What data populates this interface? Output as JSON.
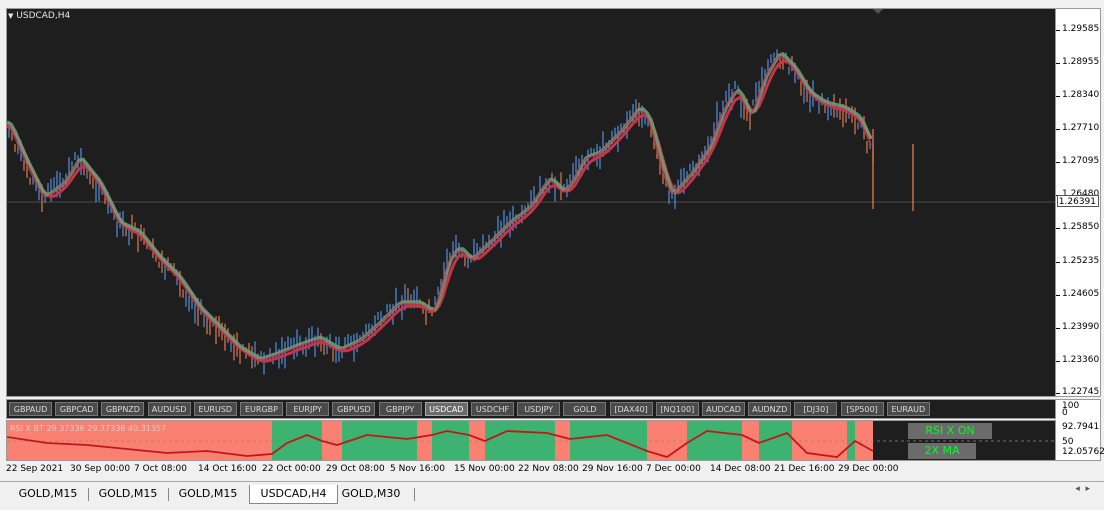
{
  "window": {
    "symbol_title": "USDCAD,H4"
  },
  "price_axis": {
    "labels": [
      "1.29585",
      "1.28955",
      "1.28340",
      "1.27710",
      "1.27095",
      "1.26480",
      "1.25850",
      "1.25235",
      "1.24605",
      "1.23990",
      "1.23360",
      "1.22745"
    ],
    "current_price": "1.26391"
  },
  "symbol_buttons": [
    "GBPAUD",
    "GBPCAD",
    "GBPNZD",
    "AUDUSD",
    "EURUSD",
    "EURGBP",
    "EURJPY",
    "GBPUSD",
    "GBPJPY",
    "USDCAD",
    "USDCHF",
    "USDJPY",
    "GOLD",
    "[DAX40]",
    "[NQ100]",
    "AUDCAD",
    "AUDNZD",
    "[DJ30]",
    "[SP500]",
    "EURAUD"
  ],
  "active_symbol": "USDCAD",
  "indicator": {
    "label": "RSI X BT 29.37336 29.37336 40.31357",
    "btn_rsi": "RSI X ON",
    "btn_ma": "2X MA",
    "axis_labels": [
      "100",
      "92.7941",
      "50",
      "12.05762",
      "0"
    ]
  },
  "time_axis": [
    "22 Sep 2021",
    "30 Sep 00:00",
    "7 Oct 08:00",
    "14 Oct 16:00",
    "22 Oct 00:00",
    "29 Oct 08:00",
    "5 Nov 16:00",
    "15 Nov 00:00",
    "22 Nov 08:00",
    "29 Nov 16:00",
    "7 Dec 00:00",
    "14 Dec 08:00",
    "21 Dec 16:00",
    "29 Dec 00:00"
  ],
  "tabs": [
    "GOLD,M15",
    "GOLD,M15",
    "GOLD,M15",
    "USDCAD,H4",
    "GOLD,M30"
  ],
  "active_tab": 3,
  "colors": {
    "chart_bg": "#1e1e1e",
    "bull_candle": "#4f8fe0",
    "bear_candle": "#e07a4a",
    "ma_red": "#c8324a",
    "ma_green": "#6fa07a",
    "rsi_green": "#3cb371",
    "rsi_red": "#fa8072",
    "rsi_line": "#c01818"
  },
  "icons": {
    "title_dropdown": "triangle-down-icon",
    "scroll_left": "arrow-left-icon",
    "scroll_right": "arrow-right-icon"
  }
}
